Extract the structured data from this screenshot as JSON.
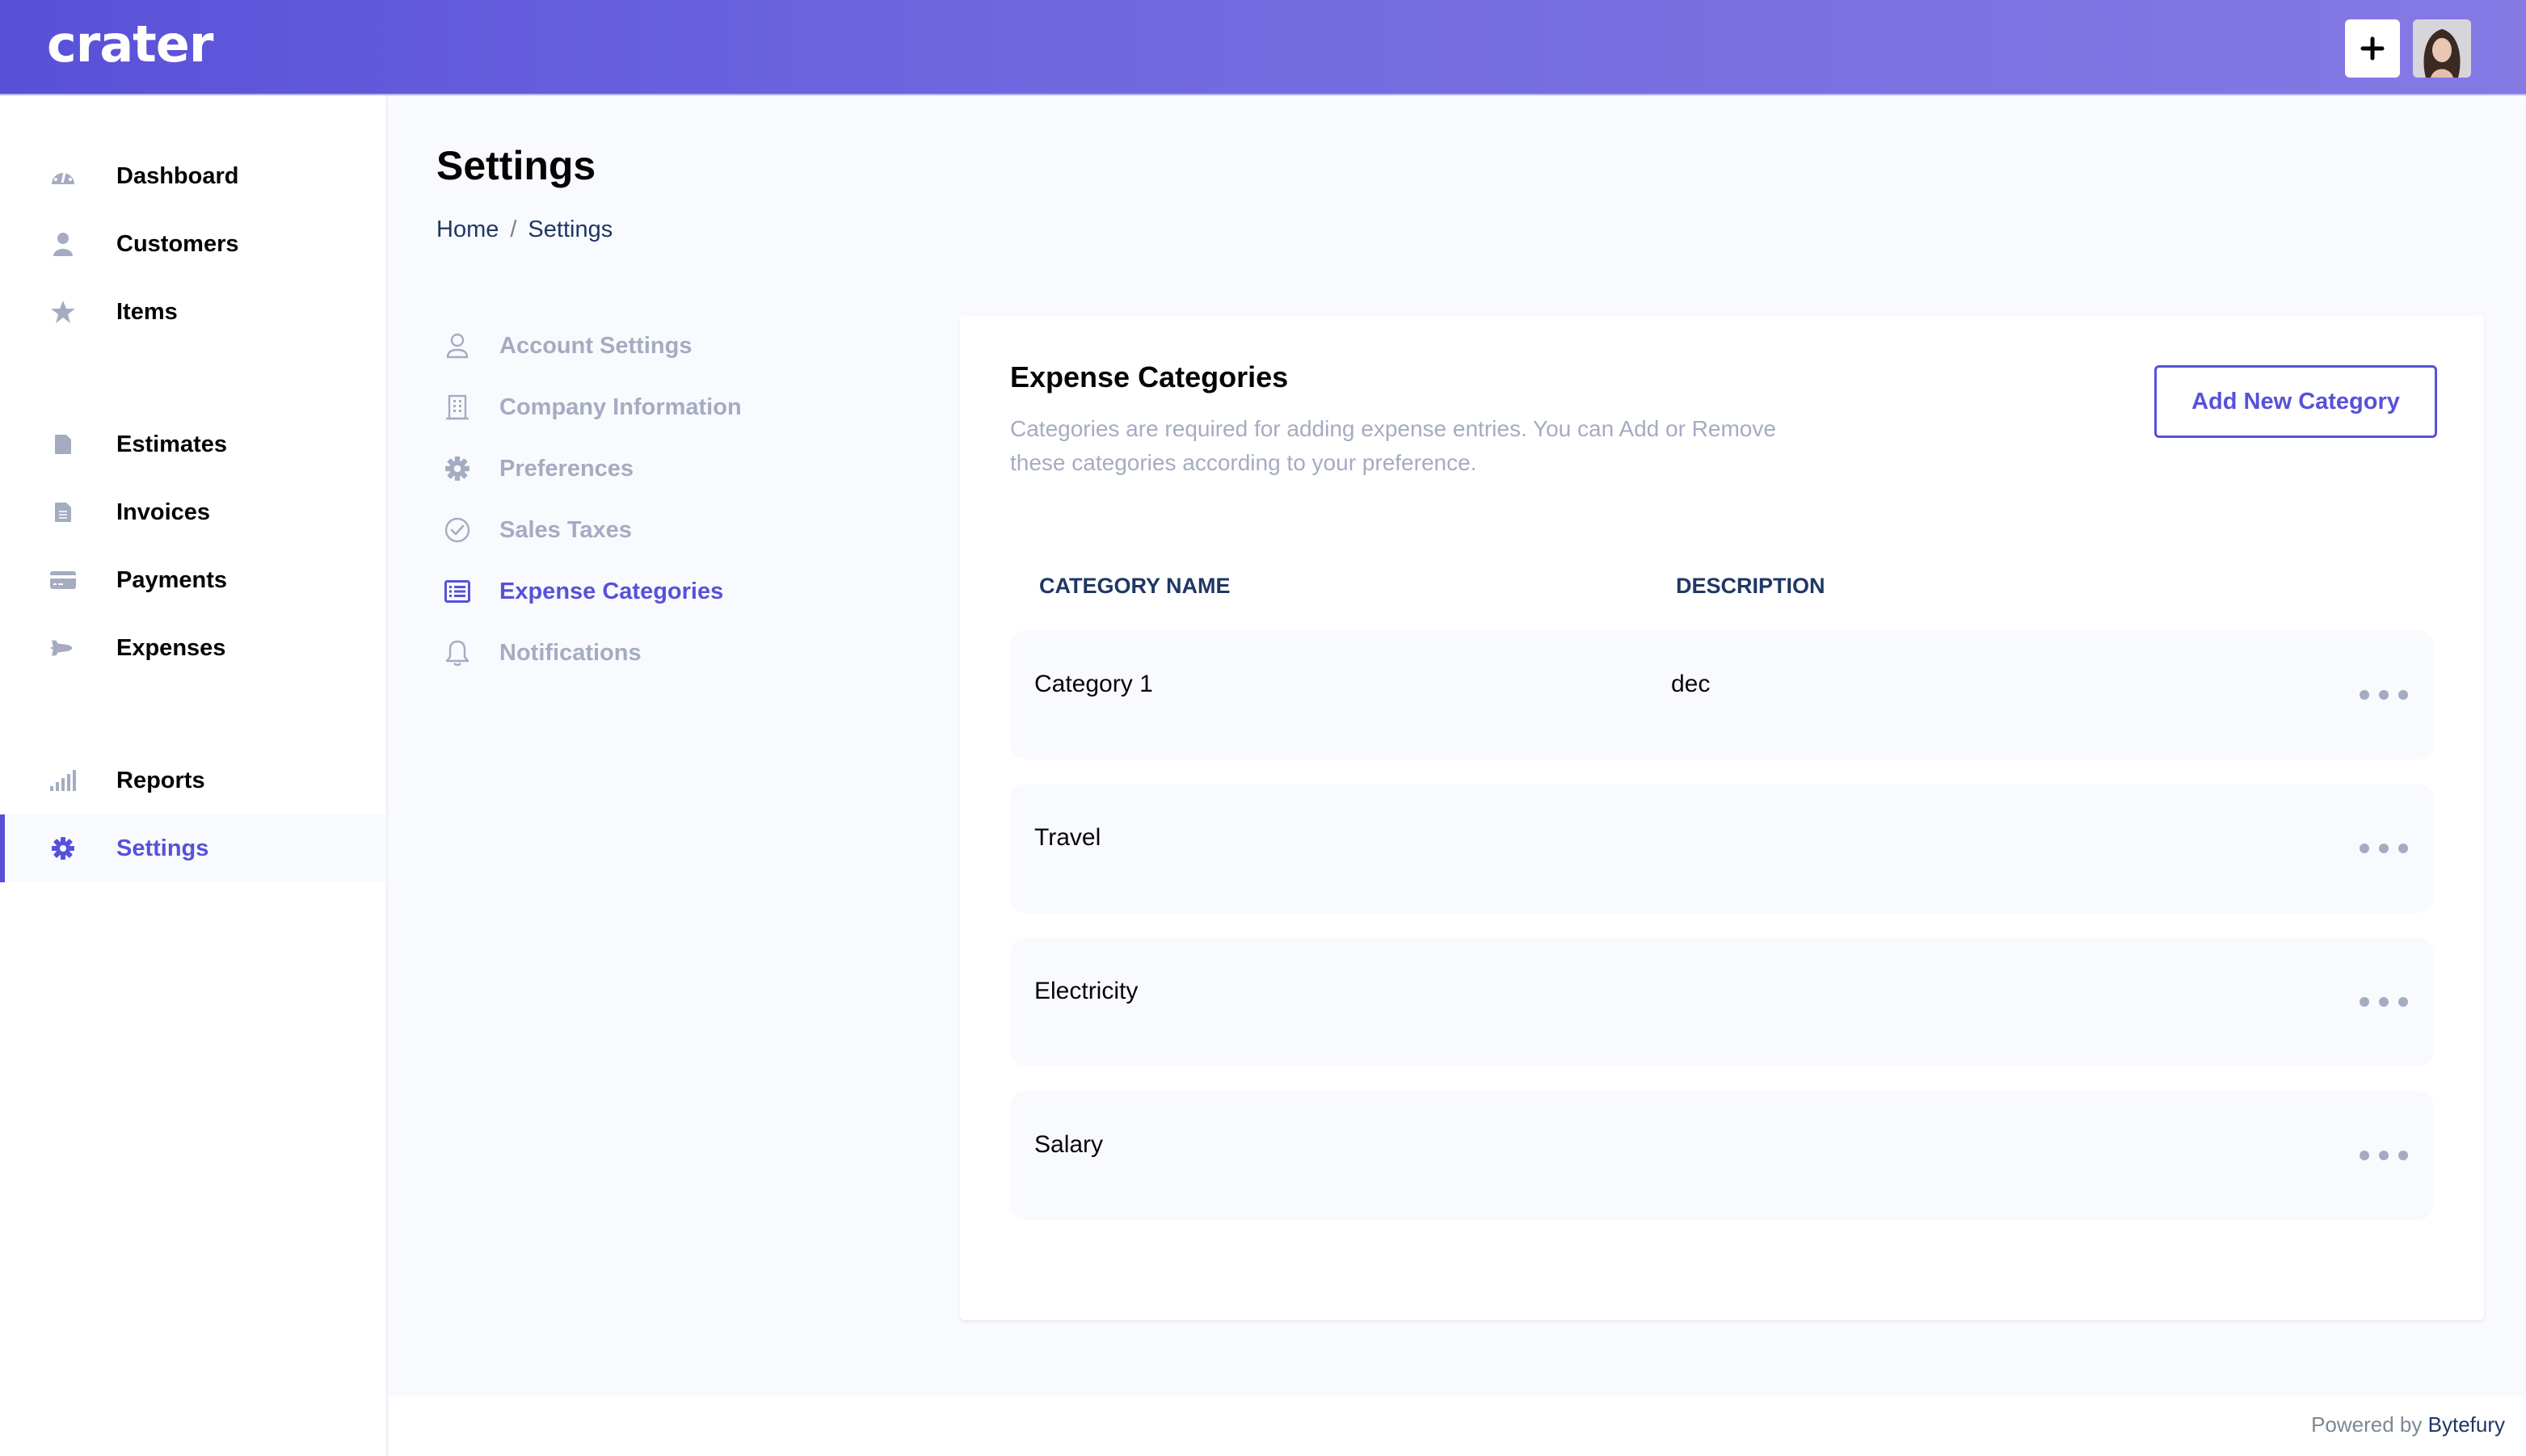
{
  "header": {
    "logo": "crater",
    "add_button_label": "+",
    "avatar_alt": "User avatar"
  },
  "sidebar": {
    "items": [
      {
        "label": "Dashboard",
        "icon": "dashboard-icon"
      },
      {
        "label": "Customers",
        "icon": "user-icon"
      },
      {
        "label": "Items",
        "icon": "star-icon"
      },
      {
        "label": "Estimates",
        "icon": "document-icon"
      },
      {
        "label": "Invoices",
        "icon": "document-text-icon"
      },
      {
        "label": "Payments",
        "icon": "credit-card-icon"
      },
      {
        "label": "Expenses",
        "icon": "space-shuttle-icon"
      },
      {
        "label": "Reports",
        "icon": "signal-icon"
      },
      {
        "label": "Settings",
        "icon": "cog-icon",
        "active": true
      }
    ]
  },
  "page": {
    "title": "Settings",
    "breadcrumb": {
      "home": "Home",
      "separator": "/",
      "current": "Settings"
    }
  },
  "settings_nav": {
    "items": [
      {
        "label": "Account Settings",
        "icon": "user-outline-icon"
      },
      {
        "label": "Company Information",
        "icon": "office-building-icon"
      },
      {
        "label": "Preferences",
        "icon": "cog-icon"
      },
      {
        "label": "Sales Taxes",
        "icon": "check-circle-icon"
      },
      {
        "label": "Expense Categories",
        "icon": "list-icon",
        "active": true
      },
      {
        "label": "Notifications",
        "icon": "bell-icon"
      }
    ]
  },
  "card": {
    "title": "Expense Categories",
    "description": "Categories are required for adding expense entries. You can Add or Remove these categories according to your preference.",
    "add_button": "Add New Category",
    "columns": {
      "name": "CATEGORY NAME",
      "description": "DESCRIPTION"
    },
    "rows": [
      {
        "name": "Category 1",
        "description": "dec"
      },
      {
        "name": "Travel",
        "description": ""
      },
      {
        "name": "Electricity",
        "description": ""
      },
      {
        "name": "Salary",
        "description": ""
      }
    ]
  },
  "footer": {
    "prefix": "Powered by",
    "brand": "Bytefury"
  },
  "colors": {
    "primary": "#5851D8",
    "muted": "#A5ACC1",
    "heading": "#1F3765",
    "bg": "#F9FAFE"
  }
}
